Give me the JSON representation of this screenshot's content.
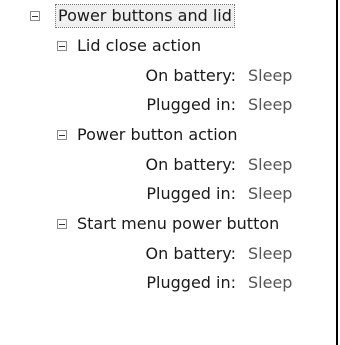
{
  "tree": {
    "root": {
      "label": "Power buttons and lid",
      "expanded": true
    },
    "groups": [
      {
        "label": "Lid close action",
        "settings": [
          {
            "key": "On battery:",
            "value": "Sleep"
          },
          {
            "key": "Plugged in:",
            "value": "Sleep"
          }
        ]
      },
      {
        "label": "Power button action",
        "settings": [
          {
            "key": "On battery:",
            "value": "Sleep"
          },
          {
            "key": "Plugged in:",
            "value": "Sleep"
          }
        ]
      },
      {
        "label": "Start menu power button",
        "settings": [
          {
            "key": "On battery:",
            "value": "Sleep"
          },
          {
            "key": "Plugged in:",
            "value": "Sleep"
          }
        ]
      }
    ]
  },
  "icons": {
    "toggle": "collapse-minus-icon"
  }
}
